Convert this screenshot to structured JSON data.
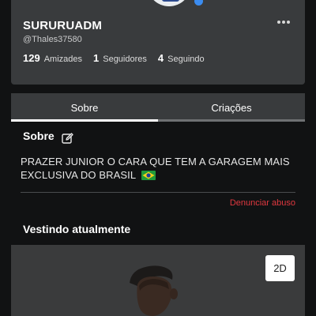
{
  "profile": {
    "username": "SURURUADM",
    "handle": "@Thales37580",
    "stats": [
      {
        "count": "129",
        "label": "Amizades"
      },
      {
        "count": "1",
        "label": "Seguidores"
      },
      {
        "count": "4",
        "label": "Seguindo"
      }
    ],
    "more_icon": "ellipsis-icon",
    "verified_icon": "verified-badge-icon"
  },
  "tabs": [
    {
      "label": "Sobre",
      "active": true
    },
    {
      "label": "Criações",
      "active": false
    }
  ],
  "about": {
    "title": "Sobre",
    "edit_icon": "pencil-edit-icon",
    "bio": "PRAZER JUNIOR O CARA QUE TEM A GARAGEM MAIS EXCLUSIVA DO BRASIL",
    "bio_emoji": "brazil-flag-icon",
    "report_label": "Denunciar abuso"
  },
  "wearing": {
    "title": "Vestindo atualmente",
    "view_toggle": "2D"
  },
  "colors": {
    "background": "#111213",
    "card": "#393b3d",
    "report": "#e0383f",
    "verified": "#3b8cf0"
  }
}
